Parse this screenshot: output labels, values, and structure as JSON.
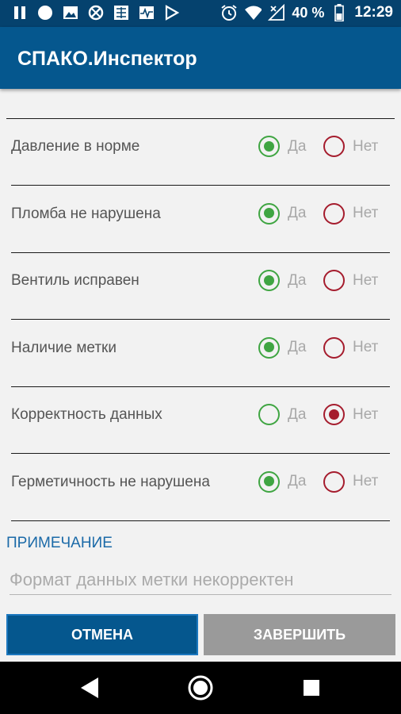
{
  "status_bar": {
    "battery": "40 %",
    "time": "12:29",
    "left_icons": [
      "pause-icon",
      "circle-icon",
      "image-icon",
      "blocked-icon",
      "grid-icon",
      "pulse-icon",
      "play-store-icon"
    ],
    "right_icons": [
      "alarm-icon",
      "wifi-icon",
      "signal-icon",
      "battery-icon"
    ]
  },
  "app_bar": {
    "title": "СПАКО.Инспектор"
  },
  "checklist": {
    "yes_label": "Да",
    "no_label": "Нет",
    "items": [
      {
        "label": "Давление в норме",
        "selected": "yes"
      },
      {
        "label": "Пломба не нарушена",
        "selected": "yes"
      },
      {
        "label": "Вентиль исправен",
        "selected": "yes"
      },
      {
        "label": "Наличие метки",
        "selected": "yes"
      },
      {
        "label": "Корректность данных",
        "selected": "no"
      },
      {
        "label": "Герметичность не нарушена",
        "selected": "yes"
      }
    ]
  },
  "note": {
    "label": "ПРИМЕЧАНИЕ",
    "placeholder": "Формат данных метки некорректен"
  },
  "buttons": {
    "cancel": "ОТМЕНА",
    "finish": "ЗАВЕРШИТЬ"
  },
  "colors": {
    "status_bar": "#05426e",
    "app_bar": "#05578e",
    "yes": "#3fa542",
    "no": "#a51c2d",
    "accent_label": "#1b6aa8",
    "disabled_button": "#9a9a9a"
  },
  "nav_bar": {
    "icons": [
      "back-icon",
      "home-icon",
      "recents-icon"
    ]
  }
}
